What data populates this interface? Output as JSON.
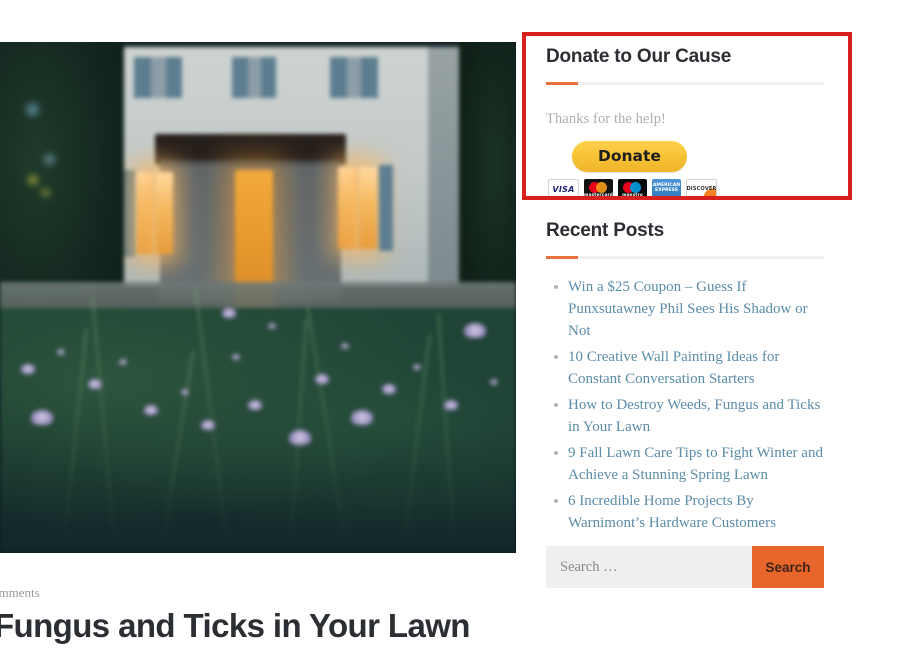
{
  "colors": {
    "accent_orange": "#e8703a",
    "button_orange": "#e8662c",
    "annotation_red": "#d8201f",
    "link_blue": "#5b8ca8",
    "heading_dark": "#2b2e33",
    "paypal_yellow": "#f7c033"
  },
  "featured_image": {
    "alt": "Blurred dusk photo of a house with warm lit windows behind a meadow of purple wildflowers"
  },
  "annotation": {
    "label": "red-highlight-box"
  },
  "donate_widget": {
    "title": "Donate to Our Cause",
    "thanks_text": "Thanks for the help!",
    "button_label": "Donate",
    "cards": [
      {
        "name": "visa",
        "label": "VISA"
      },
      {
        "name": "mastercard",
        "label": "mastercard"
      },
      {
        "name": "maestro",
        "label": "maestro"
      },
      {
        "name": "american-express",
        "label": "AMERICAN EXPRESS"
      },
      {
        "name": "discover",
        "label": "DISCOVER"
      }
    ]
  },
  "recent_posts": {
    "title": "Recent Posts",
    "items": [
      {
        "text": "Win a $25 Coupon – Guess If Punxsutawney Phil Sees His Shadow or Not"
      },
      {
        "text": "10 Creative Wall Painting Ideas for Constant Conversation Starters"
      },
      {
        "text": "How to Destroy Weeds, Fungus and Ticks in Your Lawn"
      },
      {
        "text": "9 Fall Lawn Care Tips to Fight Winter and Achieve a Stunning Spring Lawn"
      },
      {
        "text": "6 Incredible Home Projects By Warnimont’s Hardware Customers"
      }
    ]
  },
  "search": {
    "placeholder": "Search …",
    "value": "",
    "button_label": "Search"
  },
  "article": {
    "meta": "omments",
    "title": "Fungus and Ticks in Your Lawn"
  }
}
